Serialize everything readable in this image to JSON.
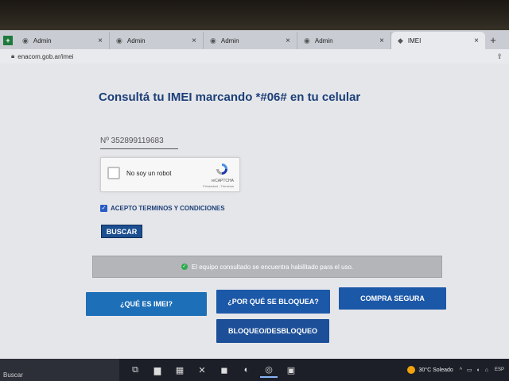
{
  "browser": {
    "tabs": [
      {
        "label": "Admin",
        "active": false
      },
      {
        "label": "Admin",
        "active": false
      },
      {
        "label": "Admin",
        "active": false
      },
      {
        "label": "Admin",
        "active": false
      },
      {
        "label": "IMEI",
        "active": true
      }
    ],
    "new_tab": "+",
    "close_glyph": "×",
    "url": "enacom.gob.ar/imei"
  },
  "page": {
    "heading": "Consultá tu IMEI marcando *#06# en tu celular",
    "imei_value": "Nº 352899119683",
    "recaptcha": {
      "label": "No soy un robot",
      "brand": "reCAPTCHA",
      "terms": "Privacidad - Términos"
    },
    "terms_label": "ACEPTO TERMINOS Y CONDICIONES",
    "terms_checked": true,
    "search_button": "BUSCAR",
    "result_message": "El equipo consultado se encuentra habilitado para el uso.",
    "buttons": {
      "que_es": "¿QUÉ ES IMEI?",
      "por_que": "¿POR QUÉ SE BLOQUEA?",
      "compra": "COMPRA SEGURA",
      "bloqueo": "BLOQUEO/DESBLOQUEO"
    }
  },
  "taskbar": {
    "search": "Buscar",
    "weather_temp": "30°C",
    "weather_desc": "Soleado",
    "lang": "ESP"
  },
  "colors": {
    "heading": "#1c3f78",
    "primary_button": "#1d6fb8",
    "success": "#2faa4f"
  }
}
